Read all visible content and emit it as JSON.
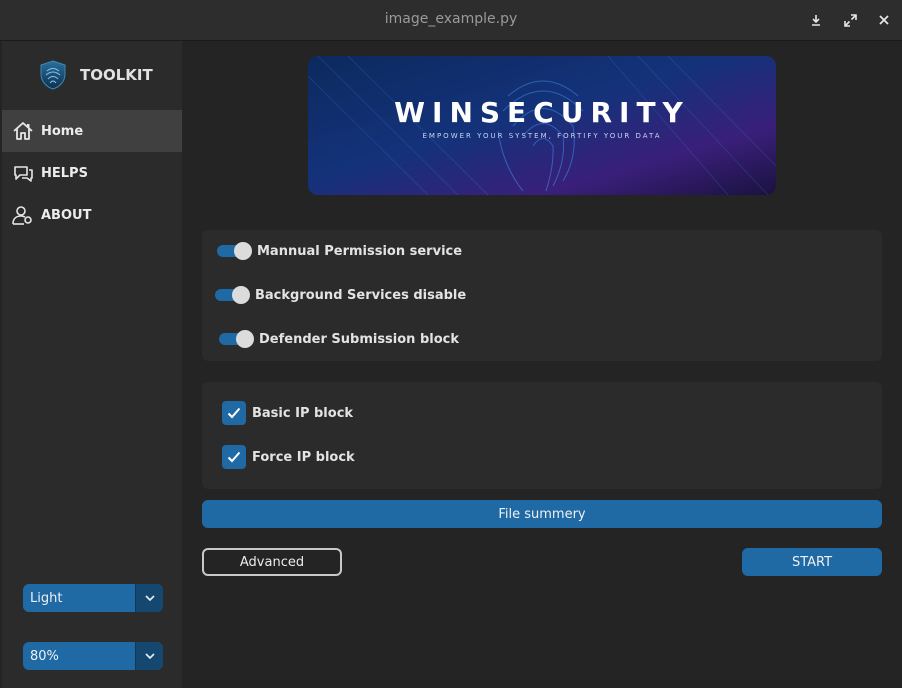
{
  "window": {
    "title": "image_example.py"
  },
  "titlebar_buttons": [
    {
      "name": "minimize-icon",
      "glyph": "⤓"
    },
    {
      "name": "maximize-icon",
      "glyph": "⤢"
    },
    {
      "name": "close-icon",
      "glyph": "✕"
    }
  ],
  "sidebar": {
    "logo_text": "TOOLKIT",
    "items": [
      {
        "label": "Home",
        "icon": "home-icon",
        "active": true
      },
      {
        "label": "HELPS",
        "icon": "chat-icon",
        "active": false
      },
      {
        "label": "ABOUT",
        "icon": "user-settings-icon",
        "active": false
      }
    ],
    "appearance_mode": {
      "value": "Light",
      "options": [
        "Light"
      ]
    },
    "scaling": {
      "value": "80%",
      "options": [
        "80%"
      ]
    }
  },
  "banner": {
    "title": "WINSECURITY",
    "subtitle": "EMPOWER YOUR SYSTEM, FORTIFY YOUR DATA"
  },
  "switches": [
    {
      "label": "Mannual Permission service",
      "on": true
    },
    {
      "label": "Background Services disable",
      "on": true
    },
    {
      "label": "Defender Submission block",
      "on": true
    }
  ],
  "checkboxes": [
    {
      "label": "Basic IP block",
      "checked": true
    },
    {
      "label": "Force IP block",
      "checked": true
    }
  ],
  "buttons": {
    "file_summary": "File summery",
    "advanced": "Advanced",
    "start": "START"
  },
  "colors": {
    "accent": "#1f6aa5",
    "accent_dark": "#144870",
    "background": "#242424",
    "panel": "#2b2b2b"
  }
}
